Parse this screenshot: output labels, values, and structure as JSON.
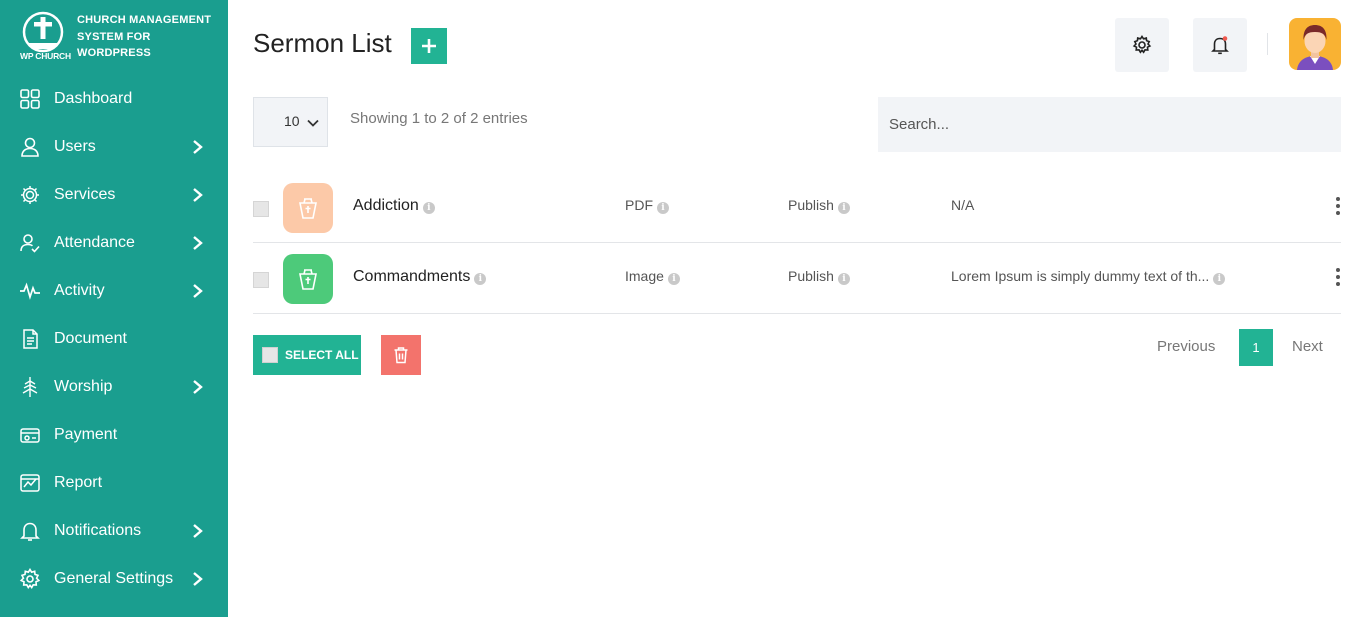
{
  "brand": {
    "title_line1": "CHURCH MANAGEMENT",
    "title_line2": "SYSTEM FOR",
    "title_line3": "WORDPRESS",
    "sub": "WP CHURCH"
  },
  "sidebar": {
    "items": [
      {
        "label": "Dashboard",
        "icon": "dashboard-icon",
        "has_submenu": false
      },
      {
        "label": "Users",
        "icon": "user-icon",
        "has_submenu": true
      },
      {
        "label": "Services",
        "icon": "services-icon",
        "has_submenu": true
      },
      {
        "label": "Attendance",
        "icon": "attendance-icon",
        "has_submenu": true
      },
      {
        "label": "Activity",
        "icon": "activity-icon",
        "has_submenu": true
      },
      {
        "label": "Document",
        "icon": "document-icon",
        "has_submenu": false
      },
      {
        "label": "Worship",
        "icon": "worship-icon",
        "has_submenu": true
      },
      {
        "label": "Payment",
        "icon": "payment-icon",
        "has_submenu": false
      },
      {
        "label": "Report",
        "icon": "report-icon",
        "has_submenu": false
      },
      {
        "label": "Notifications",
        "icon": "bell-icon",
        "has_submenu": true
      },
      {
        "label": "General Settings",
        "icon": "gear-icon",
        "has_submenu": true
      }
    ]
  },
  "header": {
    "title": "Sermon List",
    "add_icon": "plus-icon",
    "settings_icon": "gear-icon",
    "notifications_icon": "bell-icon"
  },
  "table_controls": {
    "page_length": "10",
    "showing": "Showing 1 to 2 of 2 entries",
    "search_placeholder": "Search..."
  },
  "rows": [
    {
      "name": "Addiction",
      "type": "PDF",
      "status": "Publish",
      "description": "N/A",
      "thumb_color": "#fcc9a8",
      "desc_info": false
    },
    {
      "name": "Commandments",
      "type": "Image",
      "status": "Publish",
      "description": "Lorem Ipsum is simply dummy text of th...",
      "thumb_color": "#4dca7a",
      "desc_info": true
    }
  ],
  "footer": {
    "select_all": "SELECT ALL",
    "previous": "Previous",
    "current_page": "1",
    "next": "Next"
  },
  "colors": {
    "sidebar": "#1a9e8f",
    "accent": "#22b394",
    "danger": "#f3736c"
  }
}
